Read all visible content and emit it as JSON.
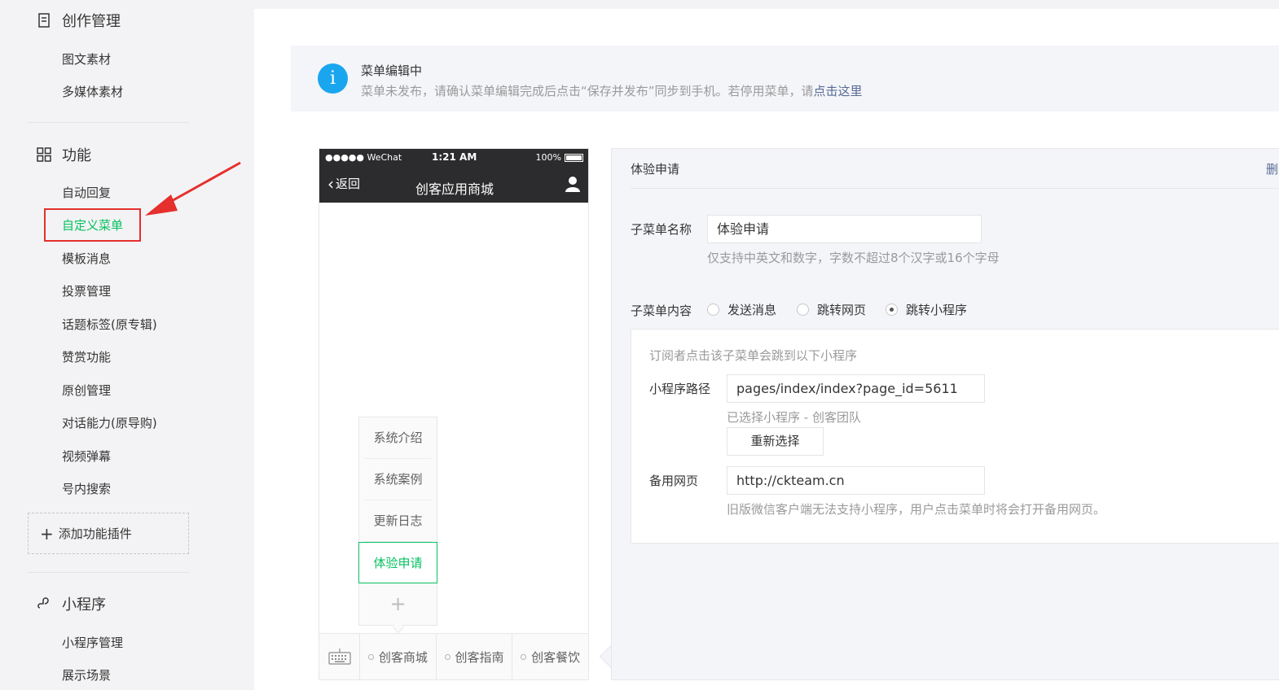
{
  "sidebar": {
    "creation": {
      "title": "创作管理",
      "items": [
        "图文素材",
        "多媒体素材"
      ]
    },
    "features": {
      "title": "功能",
      "items": [
        "自动回复",
        "自定义菜单",
        "模板消息",
        "投票管理",
        "话题标签(原专辑)",
        "赞赏功能",
        "原创管理",
        "对话能力(原导购)",
        "视频弹幕",
        "号内搜索"
      ],
      "active": "自定义菜单",
      "add_plugin": "添加功能插件"
    },
    "miniprogram": {
      "title": "小程序",
      "items": [
        "小程序管理",
        "展示场景"
      ]
    }
  },
  "notice": {
    "title": "菜单编辑中",
    "desc_prefix": "菜单未发布，请确认菜单编辑完成后点击“保存并发布”同步到手机。若停用菜单，请",
    "desc_link": "点击这里"
  },
  "phone": {
    "carrier": "●●●●● WeChat",
    "time": "1:21 AM",
    "battery": "100%",
    "back": "返回",
    "title": "创客应用商城",
    "submenu": [
      "系统介绍",
      "系统案例",
      "更新日志",
      "体验申请"
    ],
    "submenu_add": "+",
    "tabs": [
      "创客商城",
      "创客指南",
      "创客餐饮"
    ]
  },
  "editor": {
    "title": "体验申请",
    "delete": "删除子菜单",
    "name_label": "子菜单名称",
    "name_value": "体验申请",
    "name_hint": "仅支持中英文和数字，字数不超过8个汉字或16个字母",
    "content_label": "子菜单内容",
    "options": [
      "发送消息",
      "跳转网页",
      "跳转小程序"
    ],
    "selected_option": "跳转小程序",
    "panel_desc": "订阅者点击该子菜单会跳到以下小程序",
    "path_label": "小程序路径",
    "path_value": "pages/index/index?page_id=5611",
    "selected_mp": "已选择小程序 - 创客团队",
    "reselect": "重新选择",
    "backup_label": "备用网页",
    "backup_value": "http://ckteam.cn",
    "backup_hint": "旧版微信客户端无法支持小程序，用户点击菜单时将会打开备用网页。"
  },
  "colors": {
    "accent_green": "#07c160",
    "highlight_red": "#e5302d",
    "info_blue": "#1aa6ee",
    "link_blue": "#576b95"
  }
}
